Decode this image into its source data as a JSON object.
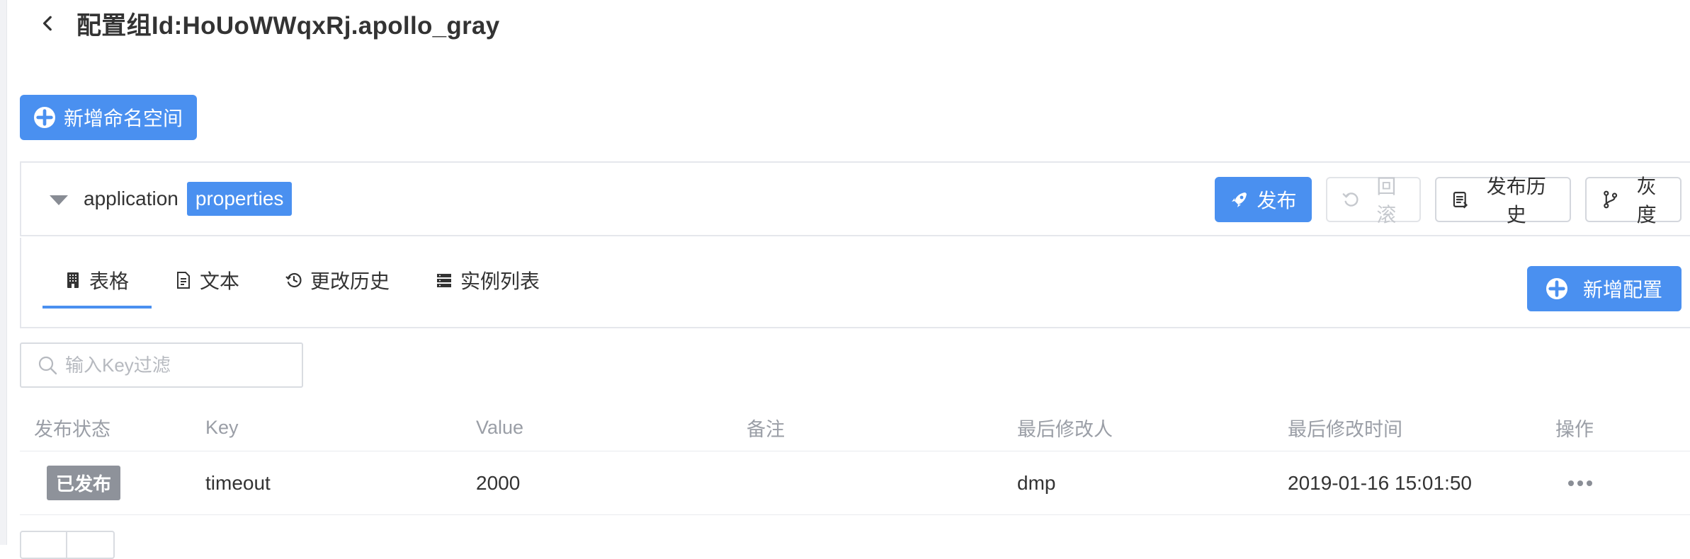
{
  "header": {
    "title": "配置组Id:HoUoWWqxRj.apollo_gray"
  },
  "toolbar": {
    "add_namespace_label": "新增命名空间"
  },
  "namespace": {
    "name": "application",
    "format": "properties",
    "actions": {
      "publish": "发布",
      "rollback": "回滚",
      "publish_history": "发布历史",
      "gray": "灰度"
    }
  },
  "tabs": [
    {
      "label": "表格",
      "icon": "table-grid-icon",
      "active": true
    },
    {
      "label": "文本",
      "icon": "document-icon",
      "active": false
    },
    {
      "label": "更改历史",
      "icon": "history-icon",
      "active": false
    },
    {
      "label": "实例列表",
      "icon": "server-list-icon",
      "active": false
    }
  ],
  "add_config_label": "新增配置",
  "filter": {
    "placeholder": "输入Key过滤",
    "value": ""
  },
  "table": {
    "columns": [
      "发布状态",
      "Key",
      "Value",
      "备注",
      "最后修改人",
      "最后修改时间",
      "操作"
    ],
    "rows": [
      {
        "status": "已发布",
        "key": "timeout",
        "value": "2000",
        "note": "",
        "modifier": "dmp",
        "modified_time": "2019-01-16 15:01:50"
      }
    ]
  },
  "colors": {
    "primary": "#4a90f0",
    "badge_gray": "#8e929a",
    "border": "#e5e7ec"
  }
}
